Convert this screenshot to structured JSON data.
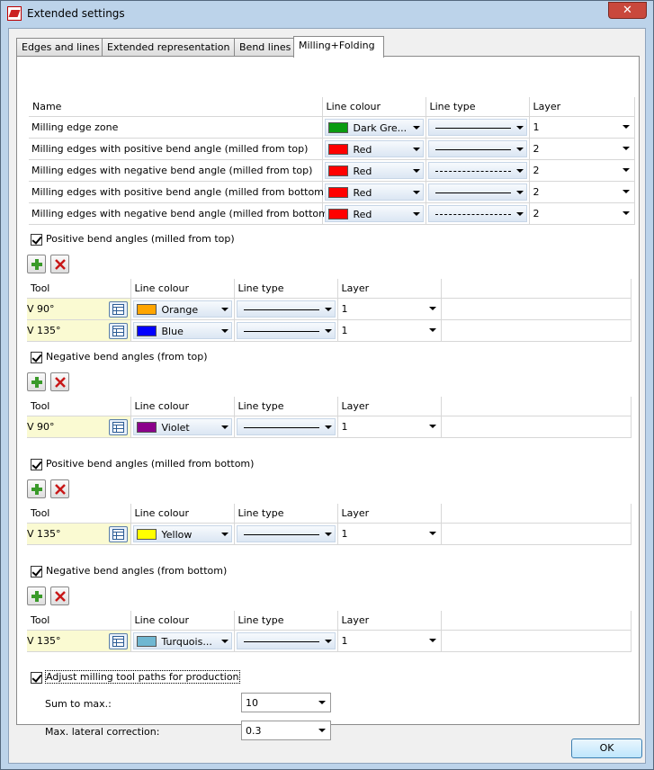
{
  "window": {
    "title": "Extended settings",
    "close_label": "✕"
  },
  "tabs": [
    {
      "label": "Edges and lines"
    },
    {
      "label": "Extended representation"
    },
    {
      "label": "Bend lines"
    },
    {
      "label": "Milling+Folding"
    }
  ],
  "main_table": {
    "headers": [
      "Name",
      "Line colour",
      "Line type",
      "Layer"
    ],
    "rows": [
      {
        "name": "Milling edge zone",
        "colour": "Dark Gre...",
        "colour_hex": "#0a9b10",
        "line": "solid",
        "layer": "1"
      },
      {
        "name": "Milling edges with positive bend angle (milled from top)",
        "colour": "Red",
        "colour_hex": "#ff0000",
        "line": "solid",
        "layer": "2"
      },
      {
        "name": "Milling edges with negative bend angle (milled from top)",
        "colour": "Red",
        "colour_hex": "#ff0000",
        "line": "dashed",
        "layer": "2"
      },
      {
        "name": "Milling edges with positive bend angle (milled from bottom)",
        "colour": "Red",
        "colour_hex": "#ff0000",
        "line": "solid",
        "layer": "2"
      },
      {
        "name": "Milling edges with negative bend angle (milled from bottom)",
        "colour": "Red",
        "colour_hex": "#ff0000",
        "line": "dashed",
        "layer": "2"
      }
    ]
  },
  "tool_headers": [
    "Tool",
    "Line colour",
    "Line type",
    "Layer"
  ],
  "sections": [
    {
      "label": "Positive bend angles (milled from top)",
      "rows": [
        {
          "tool": "V 90°",
          "colour": "Orange",
          "colour_hex": "#ffa500",
          "layer": "1"
        },
        {
          "tool": "V 135°",
          "colour": "Blue",
          "colour_hex": "#0000ff",
          "layer": "1"
        }
      ]
    },
    {
      "label": "Negative bend angles (from top)",
      "rows": [
        {
          "tool": "V 90°",
          "colour": "Violet",
          "colour_hex": "#8b008b",
          "layer": "1"
        }
      ]
    },
    {
      "label": "Positive bend angles (milled from bottom)",
      "rows": [
        {
          "tool": "V 135°",
          "colour": "Yellow",
          "colour_hex": "#ffff00",
          "layer": "1"
        }
      ]
    },
    {
      "label": "Negative bend angles (from bottom)",
      "rows": [
        {
          "tool": "V 135°",
          "colour": "Turquois...",
          "colour_hex": "#6fb7d2",
          "layer": "1"
        }
      ]
    }
  ],
  "adjust": {
    "label": "Adjust milling tool paths for production",
    "sum_label": "Sum to max.:",
    "sum_value": "10",
    "lateral_label": "Max. lateral correction:",
    "lateral_value": "0.3"
  },
  "ok_label": "OK"
}
